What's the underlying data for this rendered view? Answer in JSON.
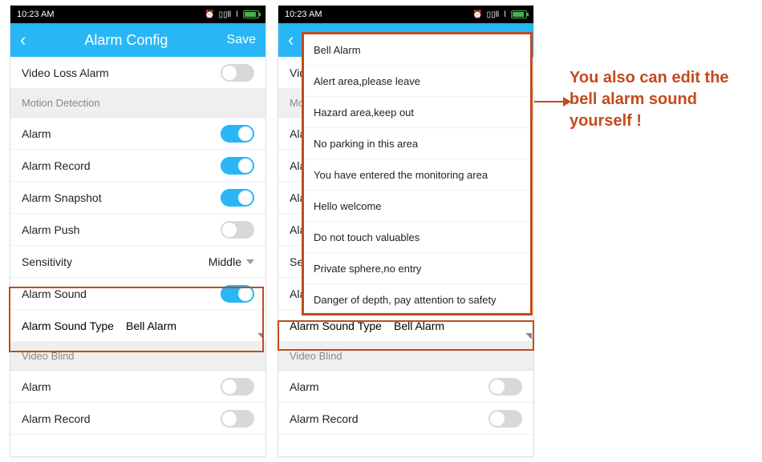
{
  "status": {
    "time": "10:23 AM",
    "alarm": "⏰",
    "signal1": "📶",
    "signal2": "📶",
    "wifi": "📡"
  },
  "nav": {
    "title": "Alarm Config",
    "save": "Save"
  },
  "rows": {
    "videoLossAlarm": "Video Loss Alarm",
    "sectionMotion": "Motion Detection",
    "alarm": "Alarm",
    "alarmRecord": "Alarm Record",
    "alarmSnapshot": "Alarm Snapshot",
    "alarmPush": "Alarm Push",
    "sensitivity": "Sensitivity",
    "sensitivityValue": "Middle",
    "alarmSound": "Alarm Sound",
    "alarmSoundType": "Alarm Sound Type",
    "alarmSoundTypeValue": "Bell Alarm",
    "sectionVideoBlind": "Video Blind"
  },
  "dropdown": [
    "Bell Alarm",
    "Alert area,please leave",
    "Hazard area,keep out",
    "No parking in this area",
    "You have entered the monitoring area",
    "Hello welcome",
    "Do not touch valuables",
    "Private sphere,no entry",
    "Danger of depth, pay attention to safety"
  ],
  "annotation": "You also can edit the bell alarm sound yourself !",
  "phone2rows": {
    "videoStub": "Video",
    "motionStub": "Motio",
    "alarmStub": "Alarm",
    "sensiStub": "Sensit"
  }
}
